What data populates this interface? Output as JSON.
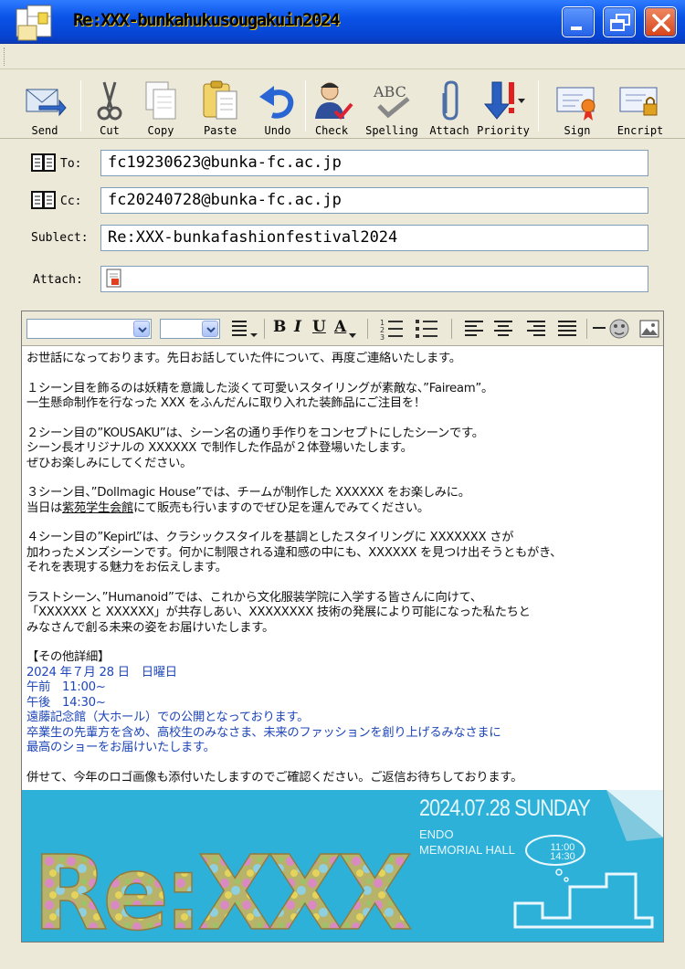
{
  "window": {
    "title": "Re:XXX-bunkahukusougakuin2024"
  },
  "toolbar": {
    "send": "Send",
    "cut": "Cut",
    "copy": "Copy",
    "paste": "Paste",
    "undo": "Undo",
    "check": "Check",
    "spelling": "Spelling",
    "attach": "Attach",
    "priority": "Priority",
    "sign": "Sign",
    "encrypt": "Encript"
  },
  "header": {
    "to_label": "To:",
    "to_value": "fc19230623@bunka-fc.ac.jp",
    "cc_label": "Cc:",
    "cc_value": "fc20240728@bunka-fc.ac.jp",
    "subject_label": "Sublect:",
    "subject_value": "Re:XXX-bunkafashionfestival2024",
    "attach_label": "Attach:"
  },
  "format": {
    "bold": "B",
    "italic": "I",
    "underline": "U",
    "font_color": "A"
  },
  "body": {
    "greeting": "お世話になっております。先日お話していた件について、再度ご連絡いたします。",
    "p1_l1": "１シーン目を飾るのは妖精を意識した淡くて可愛いスタイリングが素敵な、”Faiream”。",
    "p1_l2": "一生懸命制作を行なった XXX をふんだんに取り入れた装飾品にご注目を！",
    "p2_l1": "２シーン目の”KOUSAKU”は、シーン名の通り手作りをコンセプトにしたシーンです。",
    "p2_l2": "シーン長オリジナルの XXXXXX で制作した作品が２体登場いたします。",
    "p2_l3": "ぜひお楽しみにしてください。",
    "p3_l1": "３シーン目、”Dollmagic House”では、チームが制作した XXXXXX をお楽しみに。",
    "p3_l2_a": "当日は",
    "p3_l2_link": "紫苑学生会館",
    "p3_l2_b": "にて販売も行いますのでぜひ足を運んでみてください。",
    "p4_l1": "４シーン目の”KepirL”は、クラシックスタイルを基調としたスタイリングに XXXXXXX さが",
    "p4_l2": "加わったメンズシーンです。何かに制限される違和感の中にも、XXXXXX を見つけ出そうともがき、",
    "p4_l3": "それを表現する魅力をお伝えします。",
    "p5_l1": "ラストシーン、”Humanoid”では、これから文化服装学院に入学する皆さんに向けて、",
    "p5_l2": "「XXXXXX と XXXXXX」が共存しあい、XXXXXXXX 技術の発展により可能になった私たちと",
    "p5_l3": "みなさんで創る未来の姿をお届けいたします。",
    "details_heading": "【その他詳細】",
    "details_date": "2024 年７月 28 日　日曜日",
    "details_am": "午前　11:00~",
    "details_pm": "午後　14:30~",
    "details_venue": "遠藤記念館（大ホール）での公開となっております。",
    "details_l1": "卒業生の先輩方を含め、高校生のみなさま、未来のファッションを創り上げるみなさまに",
    "details_l2": "最高のショーをお届けいたします。",
    "closing": "併せて、今年のロゴ画像も添付いたしますのでご確認ください。ご返信お待ちしております。"
  },
  "banner": {
    "logo_text": "Re:XXX",
    "date": "2024.07.28  SUNDAY",
    "venue_l1": "ENDO",
    "venue_l2": "MEMORIAL HALL",
    "time_1": "11:00",
    "time_2": "14:30",
    "colors": {
      "background": "#2db1d9",
      "logo_fill": "#b7b36a"
    }
  }
}
